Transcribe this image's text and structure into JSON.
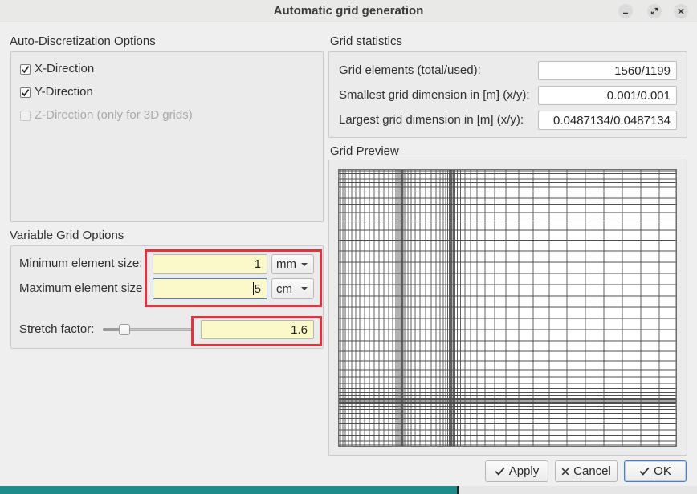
{
  "window": {
    "title": "Automatic grid generation",
    "controls": [
      {
        "name": "minimize",
        "icon": "minimize-icon"
      },
      {
        "name": "maximize",
        "icon": "maximize-icon"
      },
      {
        "name": "close",
        "icon": "close-icon"
      }
    ]
  },
  "auto_discretization": {
    "heading": "Auto-Discretization Options",
    "options": [
      {
        "label": "X-Direction",
        "checked": true,
        "enabled": true
      },
      {
        "label": "Y-Direction",
        "checked": true,
        "enabled": true
      },
      {
        "label": "Z-Direction (only for 3D grids)",
        "checked": false,
        "enabled": false
      }
    ]
  },
  "variable_grid": {
    "heading": "Variable Grid Options",
    "min_element": {
      "label": "Minimum element size:",
      "value": "1",
      "unit": "mm"
    },
    "max_element": {
      "label": "Maximum element size",
      "value": "5",
      "unit": "cm"
    },
    "stretch": {
      "label": "Stretch factor:",
      "value": "1.6",
      "slider_fraction": 0.24
    }
  },
  "grid_statistics": {
    "heading": "Grid statistics",
    "rows": [
      {
        "label": "Grid elements (total/used):",
        "value": "1560/1199"
      },
      {
        "label": "Smallest grid dimension in [m] (x/y):",
        "value": "0.001/0.001"
      },
      {
        "label": "Largest grid dimension in [m] (x/y):",
        "value": "0.0487134/0.0487134"
      }
    ]
  },
  "grid_preview": {
    "heading": "Grid Preview"
  },
  "buttons": {
    "apply": {
      "label": "Apply",
      "icon": "check-icon"
    },
    "cancel": {
      "label": "Cancel",
      "icon": "close-icon"
    },
    "ok": {
      "label": "OK",
      "icon": "check-icon"
    }
  },
  "colors": {
    "input_highlight": "#fbf8c9",
    "annotation_box": "#e3323b",
    "default_button": "#3f7fd8",
    "desktop": "#1f8c8c"
  }
}
